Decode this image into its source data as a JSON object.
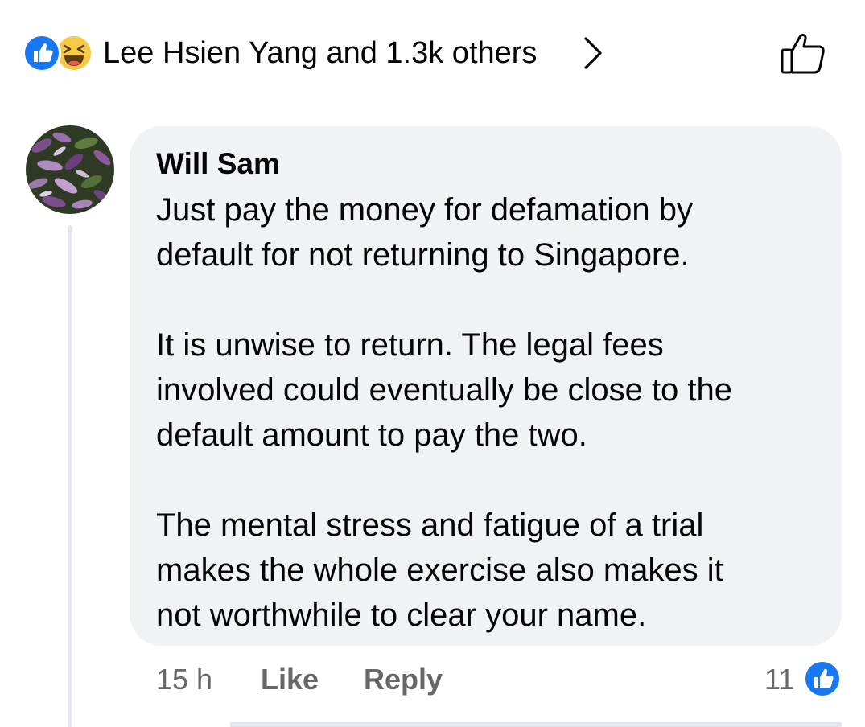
{
  "reactions": {
    "icons": [
      "like-icon",
      "haha-icon"
    ],
    "summary": "Lee Hsien Yang and 1.3k others",
    "chevron_icon": "chevron-right-icon",
    "like_button_icon": "thumbs-up-outline-icon"
  },
  "comment": {
    "author": "Will Sam",
    "avatar_icon": "profile-photo-purple-plant",
    "paragraphs": [
      "Just pay the money for defamation by\ndefault for not returning to Singapore.",
      "It is unwise to return. The legal fees\ninvolved could eventually be close to the\ndefault amount to pay the two.",
      "The mental stress and fatigue of a trial\nmakes the whole exercise also makes it\nnot worthwhile to clear your name."
    ],
    "timestamp": "15 h",
    "like_label": "Like",
    "reply_label": "Reply",
    "like_count": "11"
  },
  "colors": {
    "facebook_blue": "#1877f2",
    "bubble_bg": "#f0f2f5",
    "secondary_text": "#65676b",
    "thread_line": "#e4e6eb"
  }
}
